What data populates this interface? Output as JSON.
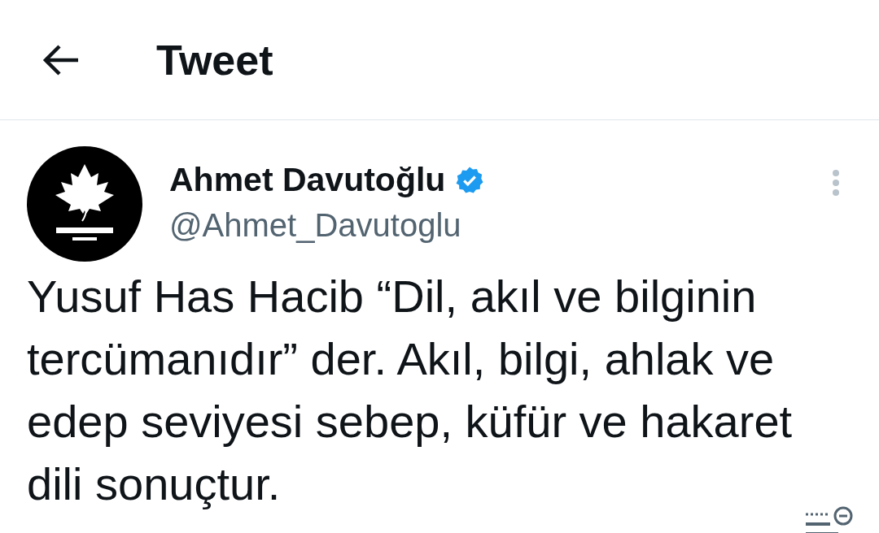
{
  "header": {
    "title": "Tweet"
  },
  "tweet": {
    "author": {
      "name": "Ahmet Davutoğlu",
      "verified": true,
      "handle": "@Ahmet_Davutoglu"
    },
    "text": "Yusuf Has Hacib “Dil, akıl ve bilginin tercümanıdır” der. Akıl, bilgi, ahlak ve edep seviyesi sebep, küfür ve hakaret dili sonuçtur."
  }
}
